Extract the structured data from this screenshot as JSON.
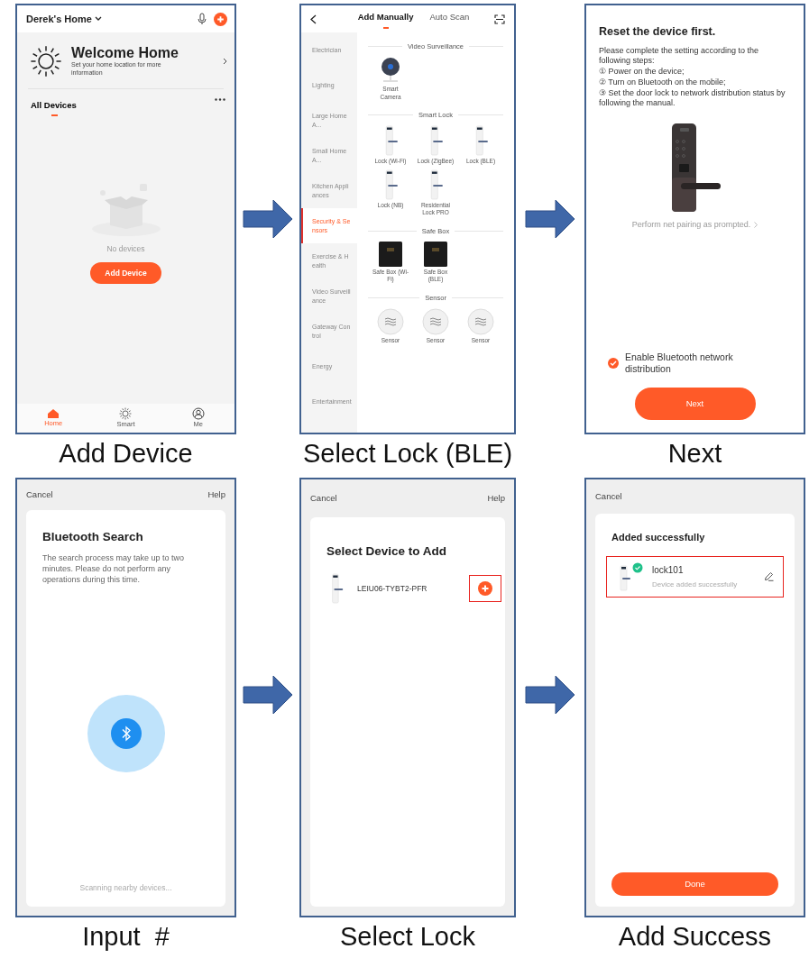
{
  "steps": [
    {
      "caption": "Add Device",
      "screen": {
        "kind": "home",
        "home_name": "Derek's Home",
        "welcome_title": "Welcome Home",
        "welcome_subtitle": "Set your home location for more information",
        "section_title": "All Devices",
        "empty_text": "No devices",
        "add_button": "Add Device",
        "nav": [
          {
            "label": "Home",
            "selected": true
          },
          {
            "label": "Smart",
            "selected": false
          },
          {
            "label": "Me",
            "selected": false
          }
        ]
      }
    },
    {
      "caption": "Select Lock (BLE)",
      "screen": {
        "kind": "catalog",
        "tabs": [
          {
            "label": "Add Manually",
            "selected": true
          },
          {
            "label": "Auto Scan",
            "selected": false
          }
        ],
        "categories": [
          {
            "label": "Electrician",
            "selected": false
          },
          {
            "label": "Lighting",
            "selected": false
          },
          {
            "label": "Large Home A...",
            "selected": false
          },
          {
            "label": "Small Home A...",
            "selected": false
          },
          {
            "label": "Kitchen Appliances",
            "selected": false
          },
          {
            "label": "Security & Sensors",
            "selected": true
          },
          {
            "label": "Exercise & Health",
            "selected": false
          },
          {
            "label": "Video Surveillance",
            "selected": false
          },
          {
            "label": "Gateway Control",
            "selected": false
          },
          {
            "label": "Energy",
            "selected": false
          },
          {
            "label": "Entertainment",
            "selected": false
          }
        ],
        "sections": [
          {
            "title": "Video Surveillance",
            "devices": [
              {
                "name": "Smart Camera",
                "kind": "camera"
              }
            ]
          },
          {
            "title": "Smart Lock",
            "devices": [
              {
                "name": "Lock (Wi-Fi)",
                "kind": "lock"
              },
              {
                "name": "Lock (ZigBee)",
                "kind": "lock"
              },
              {
                "name": "Lock (BLE)",
                "kind": "lock"
              },
              {
                "name": "Lock (NB)",
                "kind": "lock"
              },
              {
                "name": "Residential Lock PRO",
                "kind": "lock"
              }
            ]
          },
          {
            "title": "Safe Box",
            "devices": [
              {
                "name": "Safe Box (Wi-Fi)",
                "kind": "safe"
              },
              {
                "name": "Safe Box (BLE)",
                "kind": "safe"
              }
            ]
          },
          {
            "title": "Sensor",
            "devices": [
              {
                "name": "Sensor",
                "kind": "sensor"
              },
              {
                "name": "Sensor",
                "kind": "sensor"
              },
              {
                "name": "Sensor",
                "kind": "sensor"
              }
            ]
          }
        ]
      }
    },
    {
      "caption": "Next",
      "screen": {
        "kind": "reset",
        "title": "Reset the device first.",
        "intro": "Please complete the setting according to the following steps:",
        "steps": [
          {
            "num": "①",
            "text": "Power on the device;"
          },
          {
            "num": "②",
            "text": "Turn on Bluetooth on the mobile;"
          },
          {
            "num": "③",
            "text": "Set the door lock to network distribution status by following the manual."
          }
        ],
        "link": "Perform net pairing as prompted.",
        "checkbox": {
          "label": "Enable Bluetooth network distribution",
          "checked": true
        },
        "button": "Next"
      }
    },
    {
      "caption": "Input  #",
      "screen": {
        "kind": "search",
        "cancel": "Cancel",
        "help": "Help",
        "title": "Bluetooth Search",
        "description": "The search process may take up to two minutes. Please do not perform any operations during this time.",
        "status": "Scanning nearby devices..."
      }
    },
    {
      "caption": "Select Lock",
      "screen": {
        "kind": "select",
        "cancel": "Cancel",
        "help": "Help",
        "title": "Select Device to Add",
        "devices": [
          {
            "name": "LEIU06-TYBT2-PFR",
            "highlighted": true
          }
        ]
      }
    },
    {
      "caption": "Add Success",
      "screen": {
        "kind": "success",
        "cancel": "Cancel",
        "title": "Added successfully",
        "device": {
          "name": "lock101",
          "status": "Device added successfully",
          "highlighted": true
        },
        "button": "Done"
      }
    }
  ]
}
